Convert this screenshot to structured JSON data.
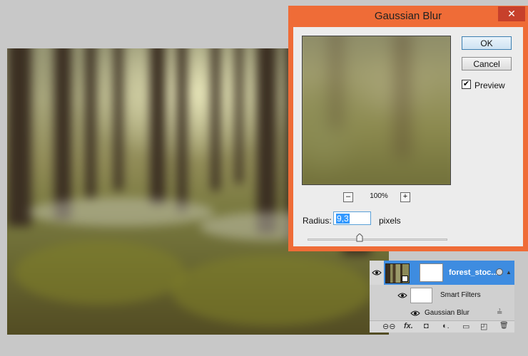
{
  "dialog": {
    "title": "Gaussian Blur",
    "close_glyph": "✕",
    "ok_label": "OK",
    "cancel_label": "Cancel",
    "preview_label": "Preview",
    "preview_checked": true,
    "zoom_level": "100%",
    "zoom_out_glyph": "–",
    "zoom_in_glyph": "+",
    "radius_label": "Radius:",
    "radius_value": "9,3",
    "radius_unit": "pixels",
    "check_glyph": "✔"
  },
  "layers": {
    "layer_name": "forest_stoc...",
    "smart_filters_label": "Smart Filters",
    "filter_name": "Gaussian Blur",
    "eye_glyph": "●",
    "toolbar": {
      "link": "⊖⊖",
      "fx": "fx.",
      "mask": "◘",
      "adjust": "◐.",
      "group": "▭",
      "new": "◰",
      "trash": "🗑"
    }
  },
  "colors": {
    "dialog_frame": "#ef6c37",
    "close_button": "#c7402b",
    "selected_layer": "#3e8ce0"
  }
}
